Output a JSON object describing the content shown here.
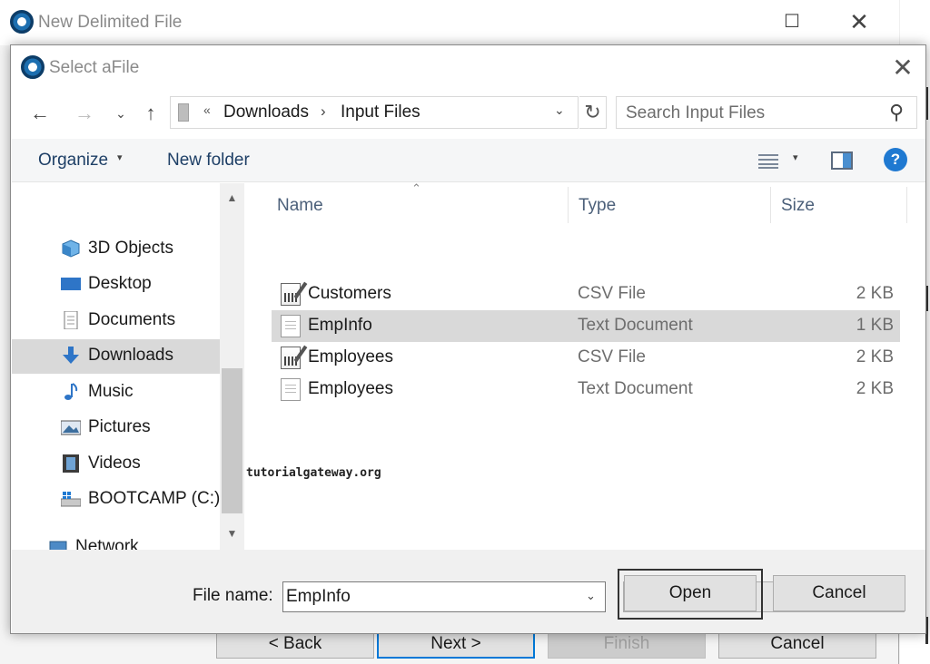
{
  "background_window": {
    "title": "New Delimited File",
    "buttons": {
      "back": "< Back",
      "next": "Next >",
      "finish": "Finish",
      "cancel": "Cancel"
    }
  },
  "dialog": {
    "title": "Select aFile",
    "address": {
      "chevrons": "«",
      "crumbs": [
        "Downloads",
        "Input Files"
      ],
      "separator": "›"
    },
    "search": {
      "placeholder": "Search Input Files"
    },
    "toolbar": {
      "organize": "Organize",
      "new_folder": "New folder",
      "help": "?"
    },
    "nav_pane": {
      "items": [
        {
          "label": "3D Objects",
          "icon": "cube-icon",
          "selected": false
        },
        {
          "label": "Desktop",
          "icon": "desktop-icon",
          "selected": false
        },
        {
          "label": "Documents",
          "icon": "documents-icon",
          "selected": false
        },
        {
          "label": "Downloads",
          "icon": "download-arrow-icon",
          "selected": true
        },
        {
          "label": "Music",
          "icon": "music-note-icon",
          "selected": false
        },
        {
          "label": "Pictures",
          "icon": "pictures-icon",
          "selected": false
        },
        {
          "label": "Videos",
          "icon": "film-icon",
          "selected": false
        },
        {
          "label": "BOOTCAMP (C:)",
          "icon": "drive-icon",
          "selected": false
        },
        {
          "label": "Network",
          "icon": "network-icon",
          "selected": false
        }
      ]
    },
    "file_list": {
      "columns": {
        "name": "Name",
        "type": "Type",
        "size": "Size"
      },
      "rows": [
        {
          "name": "Customers",
          "type": "CSV File",
          "size": "2 KB",
          "icon": "csv-file-icon",
          "selected": false
        },
        {
          "name": "EmpInfo",
          "type": "Text Document",
          "size": "1 KB",
          "icon": "text-file-icon",
          "selected": true
        },
        {
          "name": "Employees",
          "type": "CSV File",
          "size": "2 KB",
          "icon": "csv-file-icon",
          "selected": false
        },
        {
          "name": "Employees",
          "type": "Text Document",
          "size": "2 KB",
          "icon": "text-file-icon",
          "selected": false
        }
      ]
    },
    "watermark": "tutorialgateway.org",
    "bottom": {
      "filename_label": "File name:",
      "filename_value": "EmpInfo",
      "filter_value": "*",
      "open": "Open",
      "cancel": "Cancel"
    }
  },
  "colors": {
    "selection": "#d9d9d9",
    "accent": "#0078d7",
    "header_text": "#4c607a",
    "link_text": "#1e3f66"
  }
}
